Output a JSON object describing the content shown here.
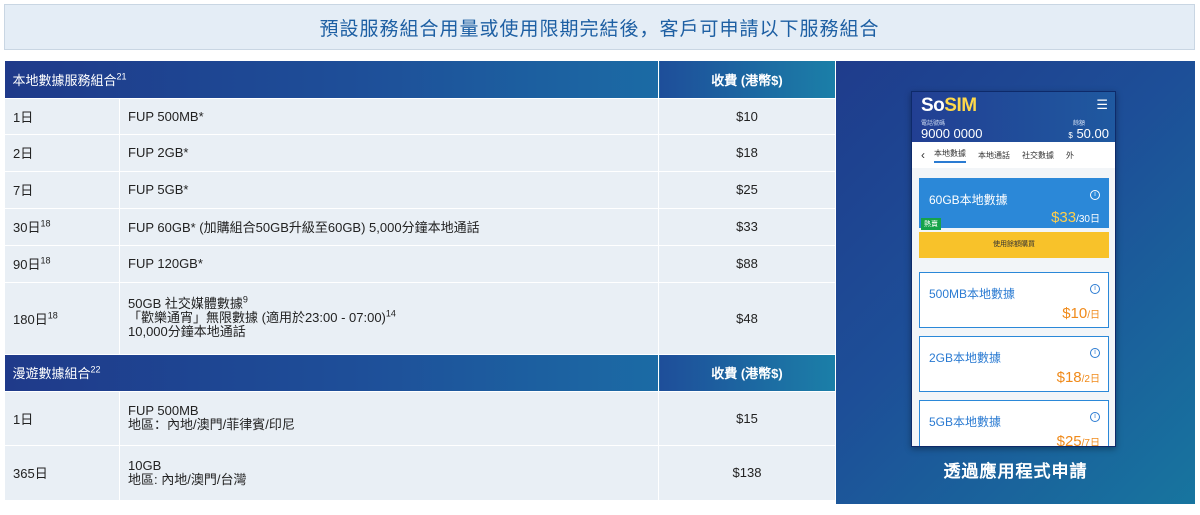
{
  "banner": {
    "title": "預設服務組合用量或使用限期完結後，客戶可申請以下服務組合"
  },
  "local_section": {
    "header": "本地數據服務組合",
    "header_sup": "21",
    "fee_header": "收費 (港幣$)",
    "rows": [
      {
        "period": "1日",
        "period_sup": "",
        "lines": [
          "FUP 500MB*"
        ],
        "line_sups": [
          ""
        ],
        "price": "$10"
      },
      {
        "period": "2日",
        "period_sup": "",
        "lines": [
          "FUP 2GB*"
        ],
        "line_sups": [
          ""
        ],
        "price": "$18"
      },
      {
        "period": "7日",
        "period_sup": "",
        "lines": [
          "FUP 5GB*"
        ],
        "line_sups": [
          ""
        ],
        "price": "$25"
      },
      {
        "period": "30日",
        "period_sup": "18",
        "lines": [
          "FUP 60GB* (加購組合50GB升級至60GB) 5,000分鐘本地通話"
        ],
        "line_sups": [
          ""
        ],
        "price": "$33"
      },
      {
        "period": "90日",
        "period_sup": "18",
        "lines": [
          "FUP 120GB*"
        ],
        "line_sups": [
          ""
        ],
        "price": "$88"
      },
      {
        "period": "180日",
        "period_sup": "18",
        "lines": [
          "50GB 社交媒體數據",
          "「歡樂通宵」無限數據 (適用於23:00 - 07:00)",
          "10,000分鐘本地通話"
        ],
        "line_sups": [
          "9",
          "14",
          ""
        ],
        "price": "$48"
      }
    ]
  },
  "roaming_section": {
    "header": "漫遊數據組合",
    "header_sup": "22",
    "fee_header": "收費 (港幣$)",
    "rows": [
      {
        "period": "1日",
        "lines": [
          "FUP 500MB",
          "地區：內地/澳門/菲律賓/印尼"
        ],
        "price": "$15"
      },
      {
        "period": "365日",
        "lines": [
          "10GB",
          "地區: 內地/澳門/台灣"
        ],
        "price": "$138"
      }
    ]
  },
  "promo": {
    "phone": {
      "logo_so": "So",
      "logo_sim": "SIM",
      "menu_icon": "hamburger-menu-icon",
      "phone_label": "電話號碼",
      "phone_number": "9000 0000",
      "balance_label": "餘額",
      "balance_currency": "$",
      "balance_value": "50.00",
      "tabs": [
        "本地數據",
        "本地通話",
        "社交數據",
        "外"
      ],
      "cards": [
        {
          "title": "60GB本地數據",
          "price": "33",
          "unit": "/30日",
          "badge": "熱賣"
        },
        {
          "title": "500MB本地數據",
          "price": "10",
          "unit": "/日"
        },
        {
          "title": "2GB本地數據",
          "price": "18",
          "unit": "/2日"
        },
        {
          "title": "5GB本地數據",
          "price": "25",
          "unit": "/7日"
        }
      ],
      "buy_button": "使用餘額購買"
    },
    "caption": "透過應用程式申請"
  }
}
